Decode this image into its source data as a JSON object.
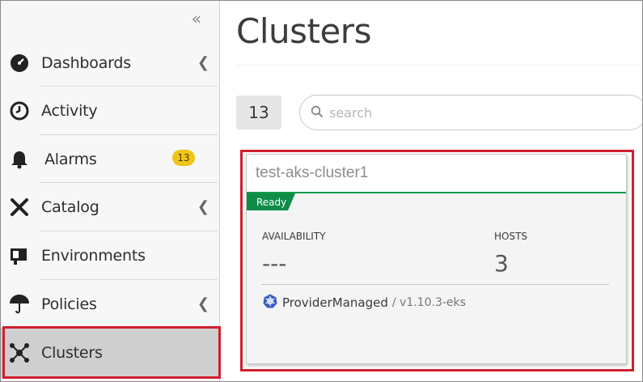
{
  "sidebar": {
    "collapse_icon": "double-chevron-left-icon",
    "items": [
      {
        "label": "Dashboards",
        "icon": "gauge-icon",
        "has_submenu": true
      },
      {
        "label": "Activity",
        "icon": "clock-icon",
        "has_submenu": false
      },
      {
        "label": "Alarms",
        "icon": "bell-icon",
        "badge": "13",
        "has_submenu": false
      },
      {
        "label": "Catalog",
        "icon": "tools-icon",
        "has_submenu": true
      },
      {
        "label": "Environments",
        "icon": "monitor-icon",
        "has_submenu": false
      },
      {
        "label": "Policies",
        "icon": "umbrella-icon",
        "has_submenu": true
      },
      {
        "label": "Clusters",
        "icon": "cluster-icon",
        "has_submenu": false,
        "active": true
      }
    ]
  },
  "main": {
    "title": "Clusters",
    "count": "13",
    "search": {
      "placeholder": "search",
      "value": ""
    }
  },
  "cards": [
    {
      "name": "test-aks-cluster1",
      "status": "Ready",
      "availability_label": "AVAILABILITY",
      "availability_value": "---",
      "hosts_label": "HOSTS",
      "hosts_value": "3",
      "provider": "ProviderManaged",
      "version": "/ v1.10.3-eks"
    }
  ],
  "colors": {
    "highlight": "#d01f2e",
    "status_green": "#0f8c47",
    "badge_yellow": "#f0c419",
    "active_bg": "#cfcfcf"
  }
}
